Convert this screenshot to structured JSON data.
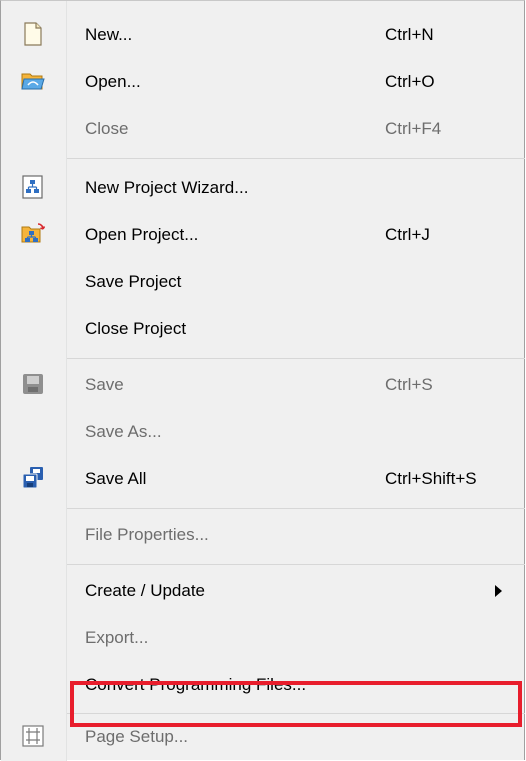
{
  "menu": {
    "items": [
      {
        "id": "new",
        "label": "New...",
        "shortcut": "Ctrl+N",
        "icon": "new-file-icon",
        "enabled": true
      },
      {
        "id": "open",
        "label": "Open...",
        "shortcut": "Ctrl+O",
        "icon": "open-folder-icon",
        "enabled": true
      },
      {
        "id": "close",
        "label": "Close",
        "shortcut": "Ctrl+F4",
        "enabled": false
      },
      {
        "id": "new-project-wizard",
        "label": "New Project Wizard...",
        "icon": "project-wizard-icon",
        "enabled": true
      },
      {
        "id": "open-project",
        "label": "Open Project...",
        "shortcut": "Ctrl+J",
        "icon": "open-project-icon",
        "enabled": true
      },
      {
        "id": "save-project",
        "label": "Save Project",
        "enabled": true
      },
      {
        "id": "close-project",
        "label": "Close Project",
        "enabled": true
      },
      {
        "id": "save",
        "label": "Save",
        "shortcut": "Ctrl+S",
        "icon": "save-disk-icon",
        "enabled": false
      },
      {
        "id": "save-as",
        "label": "Save As...",
        "enabled": false
      },
      {
        "id": "save-all",
        "label": "Save All",
        "shortcut": "Ctrl+Shift+S",
        "icon": "save-all-icon",
        "enabled": true
      },
      {
        "id": "file-properties",
        "label": "File Properties...",
        "enabled": false
      },
      {
        "id": "create-update",
        "label": "Create / Update",
        "submenu": true,
        "enabled": true
      },
      {
        "id": "export",
        "label": "Export...",
        "enabled": false
      },
      {
        "id": "convert-programming-files",
        "label": "Convert Programming Files...",
        "enabled": true,
        "highlighted": true
      },
      {
        "id": "page-setup",
        "label": "Page Setup...",
        "icon": "page-setup-icon",
        "enabled": false
      }
    ]
  },
  "colors": {
    "highlight_border": "#e81d2c",
    "disabled_text": "#6d6d6d",
    "menu_background": "#f0f0f0"
  }
}
